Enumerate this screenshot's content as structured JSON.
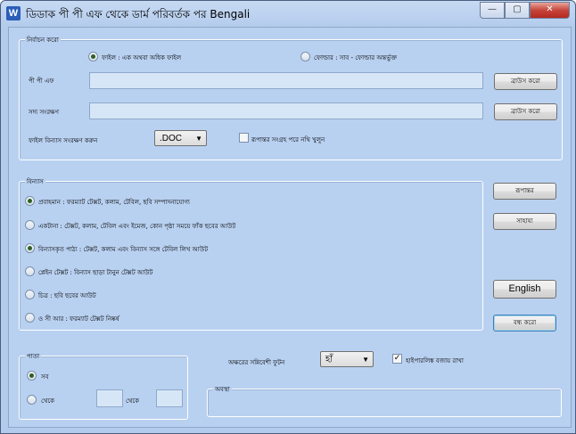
{
  "window": {
    "title": "ডিডাক পী পী এফ থেকে ডার্ম পরিবর্তক পর Bengali",
    "app_icon_letter": "W"
  },
  "caption": {
    "minimize": "—",
    "maximize": "▢",
    "close": "✕"
  },
  "conversion": {
    "group_label": "নির্বাচন করো",
    "file_radio_label": "ফাইল : এক অথবা অধিক ফাইল",
    "folder_radio_label": "ফোল্ডার : সাব - ফোল্ডার অন্তর্ভুক্ত",
    "pdf_label": "পী পী এফ",
    "pdf_value": "",
    "save_label": "সদ্য সংরক্ষণ",
    "save_value": "",
    "browse_label": "ব্রাউস করো",
    "format_label": "ফাইল বিন্যাস সংরক্ষণ করুন",
    "format_value": ".DOC",
    "open_after_label": "রূপান্তর সংগ্রহ পরে নথি খুলুন",
    "open_after_checked": false
  },
  "layout_options": {
    "group_label": "বিন্যাস",
    "options": [
      {
        "label": "প্রবাহমান : ফরম্যাট টেক্সট, কলাম, টেবিল, ছবি সম্পাদনাযোগ্য",
        "selected": true
      },
      {
        "label": "একটানা : টেক্সট, কলাম, টেবিল এবং ইমেজ, কোন পৃষ্ঠা সময়ে ফাঁক ছবের আউট",
        "selected": false
      },
      {
        "label": "বিন্যাসকৃত পাঠ্য : টেক্সট, কলাম এবং বিন্যাস সঙ্গে টেবিল লিখ আউট",
        "selected": true
      },
      {
        "label": "প্লেইন টেক্সট : বিন্যাস ছাড়া টানুন টেক্সট আউট",
        "selected": false
      },
      {
        "label": "চিত্র : ছবি ছবের আউট",
        "selected": false
      },
      {
        "label": "ও সী আর : ফরম্যাট টেক্সট নিষ্কর্ষ",
        "selected": false
      }
    ]
  },
  "actions": {
    "convert": "রূপান্তর",
    "help": "সাহায্য",
    "english": "English",
    "close": "বন্ধ করো"
  },
  "pages": {
    "group_label": "পাতা",
    "all_label": "সব",
    "from_label": "থেকে",
    "to_label": "থেকে",
    "all_selected": true,
    "from_value": "",
    "to_value": ""
  },
  "image_quality": {
    "label": "অক্ষরের সন্নিবেশী ফুটন",
    "value": "হাঁ"
  },
  "hyperlink": {
    "label": "হাইপারলিঙ্ক বজায় রাখা",
    "checked": true
  },
  "status": {
    "group_label": "অবস্থা",
    "text": ""
  }
}
